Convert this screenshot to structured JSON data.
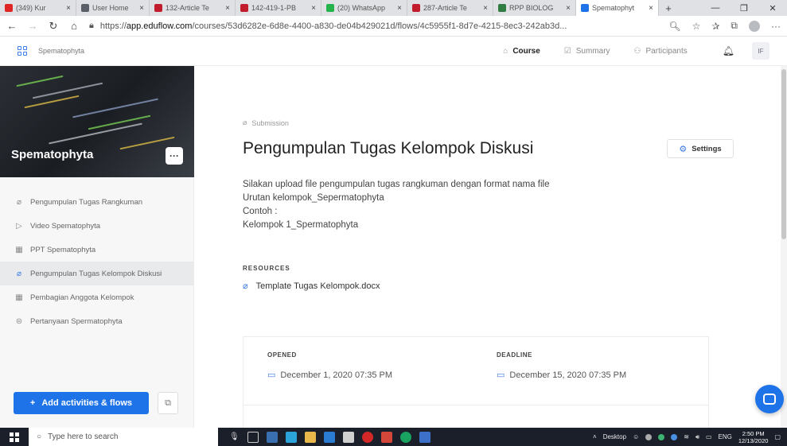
{
  "browser": {
    "tabs": [
      {
        "label": "(349) Kur",
        "favicon_color": "#e02525",
        "active": false
      },
      {
        "label": "User Home",
        "favicon_color": "#5a5f68",
        "active": false
      },
      {
        "label": "132-Article Te",
        "favicon_color": "#c21d2c",
        "active": false
      },
      {
        "label": "142-419-1-PB",
        "favicon_color": "#c21d2c",
        "active": false
      },
      {
        "label": "(20) WhatsApp",
        "favicon_color": "#25b34b",
        "active": false
      },
      {
        "label": "287-Article Te",
        "favicon_color": "#c21d2c",
        "active": false
      },
      {
        "label": "RPP BIOLOG",
        "favicon_color": "#2f7d43",
        "active": false
      },
      {
        "label": "Spematophyt",
        "favicon_color": "#1f73e8",
        "active": true
      }
    ],
    "new_tab": "+",
    "url_prefix": "https://",
    "url_host": "app.eduflow.com",
    "url_path": "/courses/53d6282e-6d8e-4400-a830-de04b429021d/flows/4c5955f1-8d7e-4215-8ec3-242ab3d..."
  },
  "app_header": {
    "brand": "Spematophyta",
    "nav": [
      {
        "label": "Course",
        "icon": "home-icon",
        "active": true
      },
      {
        "label": "Summary",
        "icon": "summary-icon",
        "active": false
      },
      {
        "label": "Participants",
        "icon": "participants-icon",
        "active": false
      }
    ],
    "user_initials": "IF"
  },
  "sidebar": {
    "course_title": "Spematophyta",
    "more_label": "···",
    "items": [
      {
        "label": "Pengumpulan Tugas Rangkuman",
        "icon": "paperclip-icon",
        "glyph": "⌀",
        "active": false
      },
      {
        "label": "Video Spematophyta",
        "icon": "play-icon",
        "glyph": "▷",
        "active": false
      },
      {
        "label": "PPT Spematophyta",
        "icon": "slides-icon",
        "glyph": "▦",
        "active": false
      },
      {
        "label": "Pengumpulan Tugas Kelompok Diskusi",
        "icon": "paperclip-icon",
        "glyph": "⌀",
        "active": true
      },
      {
        "label": "Pembagian Anggota Kelompok",
        "icon": "table-icon",
        "glyph": "▦",
        "active": false
      },
      {
        "label": "Pertanyaan Spermatophyta",
        "icon": "question-icon",
        "glyph": "⊜",
        "active": false
      }
    ],
    "add_button": "Add activities & flows"
  },
  "main": {
    "crumb": "Submission",
    "title": "Pengumpulan Tugas Kelompok Diskusi",
    "settings_label": "Settings",
    "description": [
      "Silakan upload file pengumpulan tugas rangkuman dengan format nama file",
      "Urutan kelompok_Sepermatophyta",
      "Contoh :",
      "Kelompok 1_Spermatophyta"
    ],
    "resources_heading": "RESOURCES",
    "resource_file": "Template Tugas Kelompok.docx",
    "opened_label": "OPENED",
    "opened_value": "December 1, 2020 07:35 PM",
    "deadline_label": "DEADLINE",
    "deadline_value": "December 15, 2020 07:35 PM"
  },
  "taskbar": {
    "search_placeholder": "Type here to search",
    "desktop_label": "Desktop",
    "lang": "ENG",
    "time": "2:50 PM",
    "date": "12/13/2020"
  },
  "colors": {
    "accent": "#1f73e8",
    "sidebar_bg": "#f7f7f8",
    "taskbar_bg": "#1b1f2a"
  }
}
